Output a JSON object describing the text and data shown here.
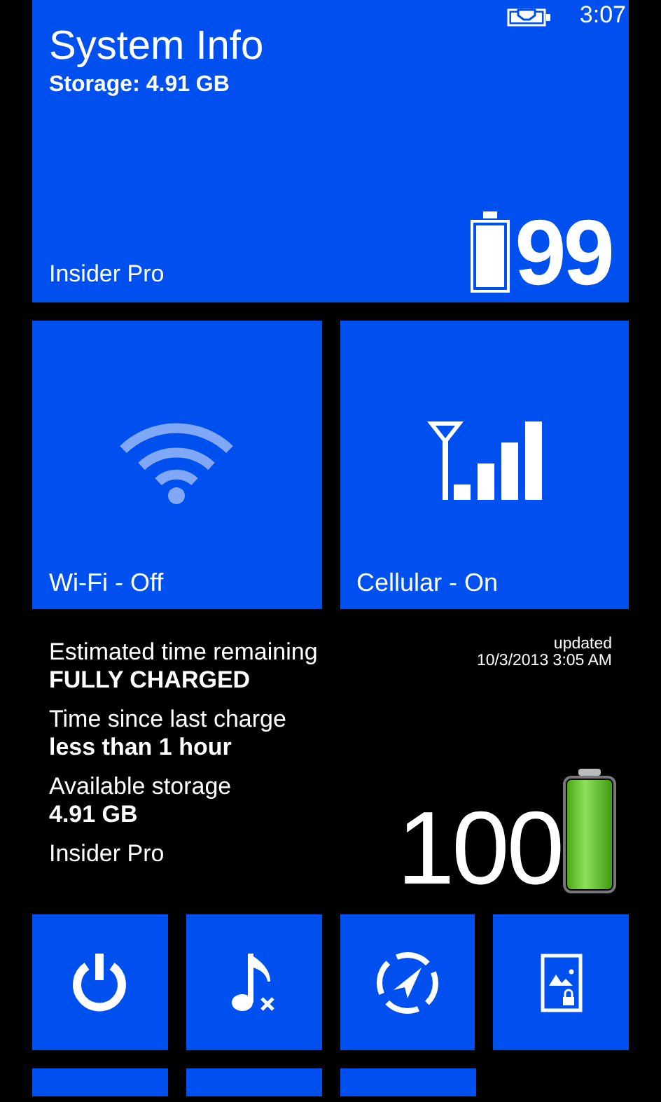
{
  "status_bar": {
    "time": "3:07",
    "charging": true
  },
  "system_tile": {
    "title": "System Info",
    "subtitle": "Storage: 4.91 GB",
    "footer": "Insider Pro",
    "battery_percent": "99",
    "level": 0.99
  },
  "network_tiles": [
    {
      "kind": "wifi",
      "label": "Wi-Fi - Off",
      "on": false
    },
    {
      "kind": "cellular",
      "label": "Cellular - On",
      "on": true
    }
  ],
  "info": {
    "updated_label": "updated",
    "updated_time": "10/3/2013 3:05 AM",
    "items": [
      {
        "label": "Estimated time remaining",
        "value": "FULLY CHARGED"
      },
      {
        "label": "Time since last charge",
        "value": "less than 1 hour"
      },
      {
        "label": "Available storage",
        "value": "4.91 GB"
      }
    ],
    "footer": "Insider Pro",
    "battery_percent": "100",
    "level": 1.0
  },
  "action_tiles": [
    {
      "kind": "power"
    },
    {
      "kind": "mute"
    },
    {
      "kind": "location"
    },
    {
      "kind": "lockscreen"
    }
  ]
}
